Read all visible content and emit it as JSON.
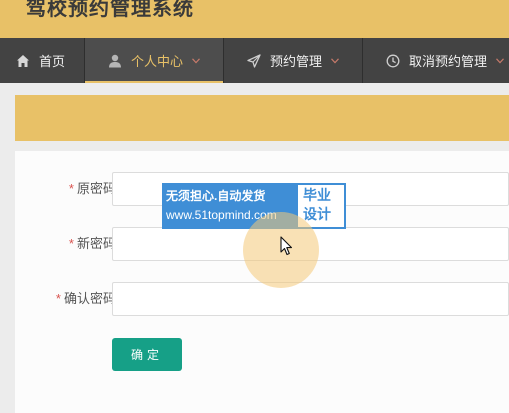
{
  "app": {
    "title": "驾校预约管理系统"
  },
  "nav": {
    "items": [
      {
        "label": "首页",
        "icon": "home-icon"
      },
      {
        "label": "个人中心",
        "icon": "user-icon",
        "active": true
      },
      {
        "label": "预约管理",
        "icon": "send-icon"
      },
      {
        "label": "取消预约管理",
        "icon": "clock-icon"
      }
    ]
  },
  "form": {
    "required_mark": "*",
    "fields": [
      {
        "label": "原密码",
        "value": ""
      },
      {
        "label": "新密码",
        "value": ""
      },
      {
        "label": "确认密码",
        "value": ""
      }
    ],
    "submit_label": "确定"
  },
  "watermark": {
    "line1": "无须担心.自动发货",
    "line2": "www.51topmind.com",
    "badge_line1": "毕业",
    "badge_line2": "设计"
  },
  "colors": {
    "accent": "#e8c167",
    "nav_bg": "#434343",
    "primary_button": "#16a087",
    "required": "#d9534f"
  }
}
